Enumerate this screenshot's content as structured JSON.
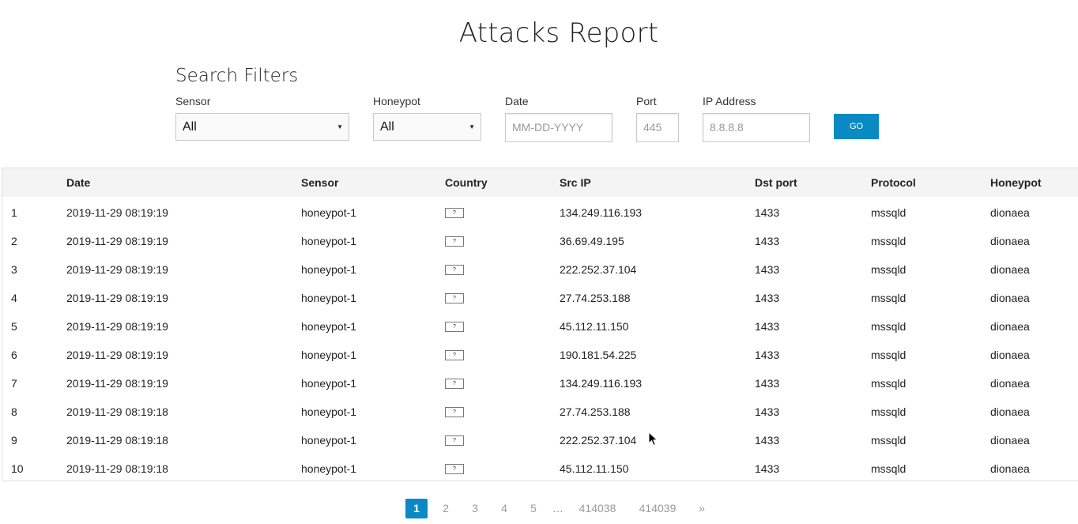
{
  "page": {
    "title": "Attacks Report"
  },
  "filters": {
    "title": "Search Filters",
    "sensor": {
      "label": "Sensor",
      "value": "All"
    },
    "honeypot": {
      "label": "Honeypot",
      "value": "All"
    },
    "date": {
      "label": "Date",
      "placeholder": "MM-DD-YYYY"
    },
    "port": {
      "label": "Port",
      "placeholder": "445"
    },
    "ip": {
      "label": "IP Address",
      "placeholder": "8.8.8.8"
    },
    "go_label": "GO"
  },
  "table": {
    "headers": [
      "",
      "Date",
      "Sensor",
      "Country",
      "Src IP",
      "Dst port",
      "Protocol",
      "Honeypot"
    ],
    "unknown_flag": "?",
    "rows": [
      {
        "num": "1",
        "date": "2019-11-29 08:19:19",
        "sensor": "honeypot-1",
        "src_ip": "134.249.116.193",
        "dst_port": "1433",
        "protocol": "mssqld",
        "honeypot": "dionaea"
      },
      {
        "num": "2",
        "date": "2019-11-29 08:19:19",
        "sensor": "honeypot-1",
        "src_ip": "36.69.49.195",
        "dst_port": "1433",
        "protocol": "mssqld",
        "honeypot": "dionaea"
      },
      {
        "num": "3",
        "date": "2019-11-29 08:19:19",
        "sensor": "honeypot-1",
        "src_ip": "222.252.37.104",
        "dst_port": "1433",
        "protocol": "mssqld",
        "honeypot": "dionaea"
      },
      {
        "num": "4",
        "date": "2019-11-29 08:19:19",
        "sensor": "honeypot-1",
        "src_ip": "27.74.253.188",
        "dst_port": "1433",
        "protocol": "mssqld",
        "honeypot": "dionaea"
      },
      {
        "num": "5",
        "date": "2019-11-29 08:19:19",
        "sensor": "honeypot-1",
        "src_ip": "45.112.11.150",
        "dst_port": "1433",
        "protocol": "mssqld",
        "honeypot": "dionaea"
      },
      {
        "num": "6",
        "date": "2019-11-29 08:19:19",
        "sensor": "honeypot-1",
        "src_ip": "190.181.54.225",
        "dst_port": "1433",
        "protocol": "mssqld",
        "honeypot": "dionaea"
      },
      {
        "num": "7",
        "date": "2019-11-29 08:19:19",
        "sensor": "honeypot-1",
        "src_ip": "134.249.116.193",
        "dst_port": "1433",
        "protocol": "mssqld",
        "honeypot": "dionaea"
      },
      {
        "num": "8",
        "date": "2019-11-29 08:19:18",
        "sensor": "honeypot-1",
        "src_ip": "27.74.253.188",
        "dst_port": "1433",
        "protocol": "mssqld",
        "honeypot": "dionaea"
      },
      {
        "num": "9",
        "date": "2019-11-29 08:19:18",
        "sensor": "honeypot-1",
        "src_ip": "222.252.37.104",
        "dst_port": "1433",
        "protocol": "mssqld",
        "honeypot": "dionaea"
      },
      {
        "num": "10",
        "date": "2019-11-29 08:19:18",
        "sensor": "honeypot-1",
        "src_ip": "45.112.11.150",
        "dst_port": "1433",
        "protocol": "mssqld",
        "honeypot": "dionaea"
      }
    ]
  },
  "pagination": {
    "current": "1",
    "pages": [
      "1",
      "2",
      "3",
      "4",
      "5",
      "…",
      "414038",
      "414039",
      "»"
    ]
  },
  "colors": {
    "accent": "#0a8ac4",
    "header_bg": "#f4f4f4"
  }
}
